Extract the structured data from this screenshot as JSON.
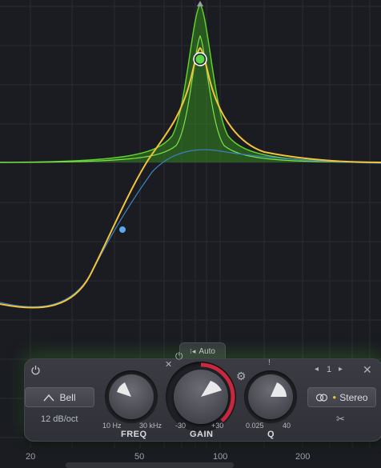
{
  "colors": {
    "background": "#1b1c21",
    "grid": "#2c2d33",
    "curve_yellow": "#f2c33b",
    "curve_green": "#5fcf2c",
    "curve_blue": "#3a7fb8",
    "band_node": "#58d64a",
    "handle_blue": "#5aa8f0",
    "gain_arc": "#c9283d"
  },
  "frequency_axis": {
    "labels": [
      "20",
      "50",
      "100",
      "200"
    ]
  },
  "band_panel": {
    "auto_label": "Auto",
    "shape_label": "Bell",
    "slope_label": "12 dB/oct",
    "freq": {
      "label": "FREQ",
      "min": "10 Hz",
      "max": "30 kHz"
    },
    "gain": {
      "label": "GAIN",
      "min": "-30",
      "max": "+30"
    },
    "q": {
      "label": "Q",
      "min": "0.025",
      "max": "40"
    },
    "band_number": "1",
    "stereo_label": "Stereo"
  },
  "icons": {
    "power": "power-icon",
    "close": "close-icon",
    "prev": "chevron-left-icon",
    "next": "chevron-right-icon",
    "bell": "bell-shape-icon",
    "stereo": "stereo-rings-icon",
    "scissors": "scissors-icon",
    "gear": "gear-icon",
    "reset": "x-icon"
  }
}
